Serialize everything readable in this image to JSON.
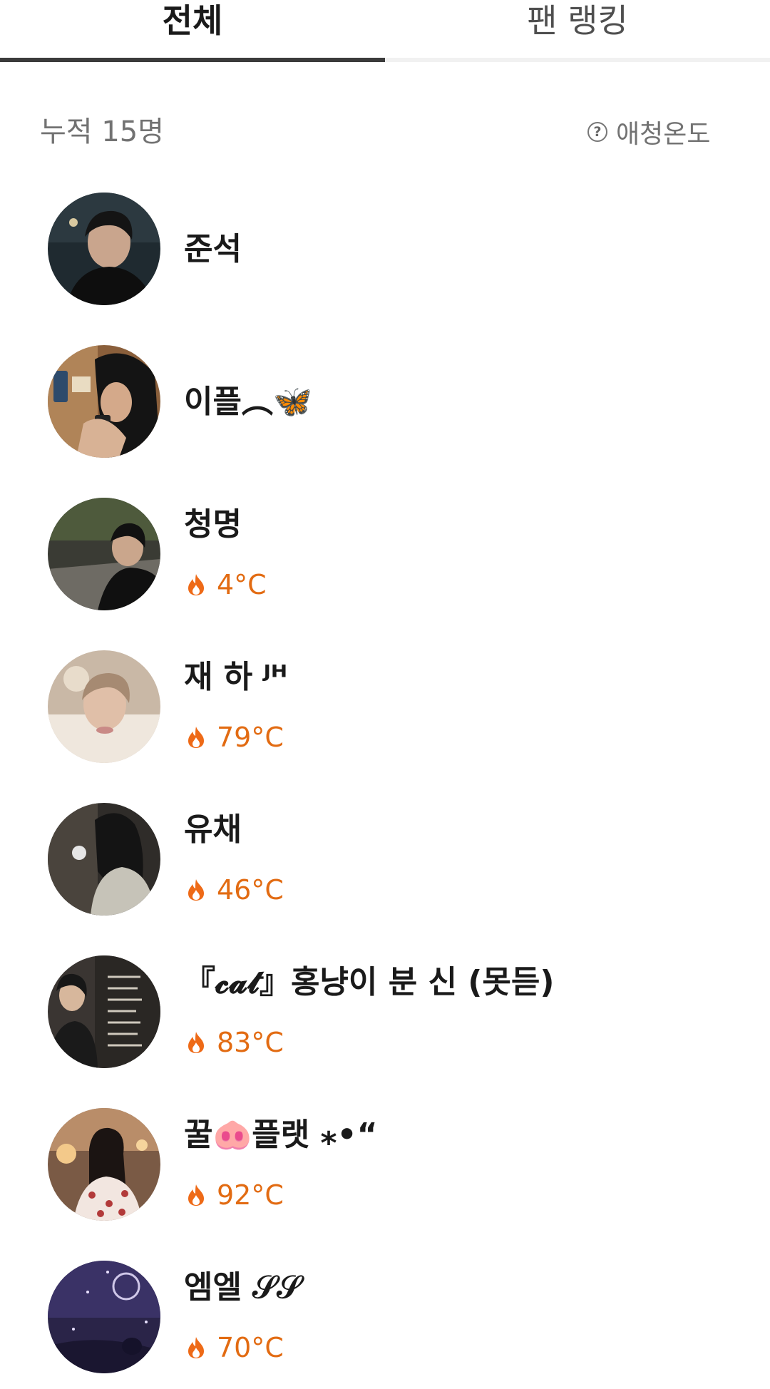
{
  "tabs": [
    {
      "label": "전체",
      "active": true
    },
    {
      "label": "팬 랭킹",
      "active": false
    }
  ],
  "summary": {
    "count_text": "누적 15명",
    "help_label": "애청온도",
    "help_icon": "question-circle-icon"
  },
  "colors": {
    "accent": "#e26b12",
    "tab_underline": "#3b3b3b",
    "muted_text": "#727272"
  },
  "fans": [
    {
      "name": "준석",
      "temperature": null,
      "avatar": "profile-photo"
    },
    {
      "name": "이플︵🦋",
      "temperature": null,
      "avatar": "profile-photo"
    },
    {
      "name": "청명",
      "temperature": "4°C",
      "avatar": "profile-photo"
    },
    {
      "name": "재 하 ᴶᴴ",
      "temperature": "79°C",
      "avatar": "profile-photo"
    },
    {
      "name": "유채",
      "temperature": "46°C",
      "avatar": "profile-photo"
    },
    {
      "name": "『𝓬𝓪𝓽』홍냥이 분 신 (못듣)",
      "temperature": "83°C",
      "avatar": "profile-photo"
    },
    {
      "name": "꿀🐽플랫          ⁎•“",
      "temperature": "92°C",
      "avatar": "profile-photo"
    },
    {
      "name": "엠엘 𝒮𝒮",
      "temperature": "70°C",
      "avatar": "profile-photo"
    }
  ]
}
